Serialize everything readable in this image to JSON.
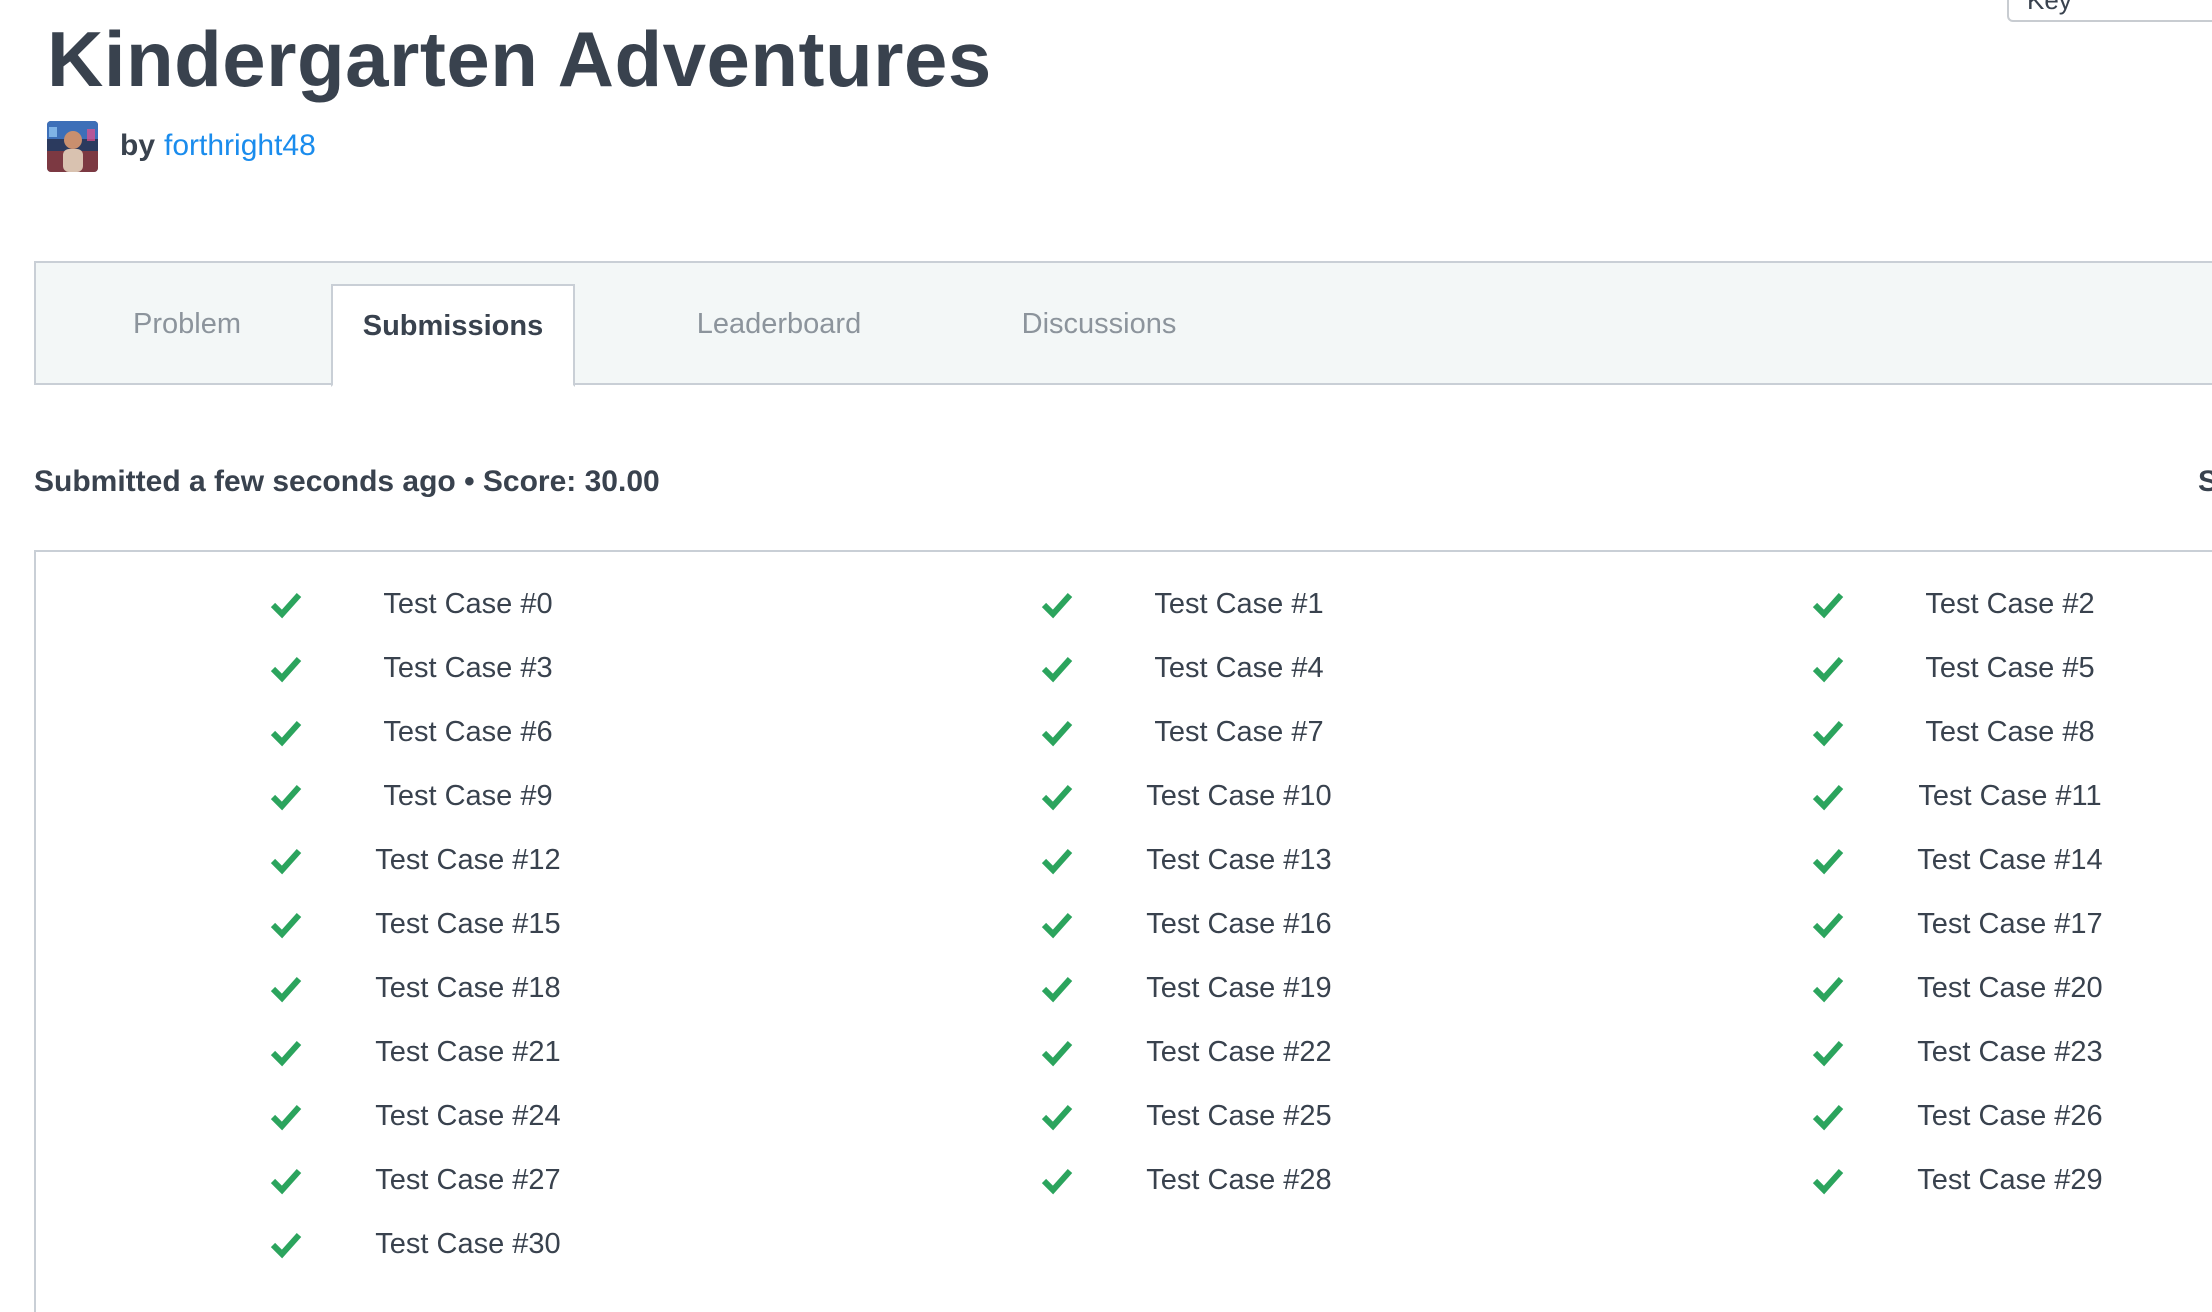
{
  "key_field": {
    "label": "Key"
  },
  "challenge": {
    "title": "Kindergarten Adventures",
    "by_label": "by",
    "author": "forthright48"
  },
  "tabs": [
    {
      "label": "Problem",
      "active": false
    },
    {
      "label": "Submissions",
      "active": true
    },
    {
      "label": "Leaderboard",
      "active": false
    },
    {
      "label": "Discussions",
      "active": false
    }
  ],
  "submission": {
    "status_text": "Submitted a few seconds ago • Score: 30.00",
    "right_cut_text": "S"
  },
  "colors": {
    "pass_green": "#2ba45d",
    "link_blue": "#1a8ced",
    "text_dark": "#39424e",
    "tab_inactive": "#8c949c"
  },
  "test_cases": [
    {
      "label": "Test Case #0",
      "status": "passed",
      "icon": "check-icon"
    },
    {
      "label": "Test Case #1",
      "status": "passed",
      "icon": "check-icon"
    },
    {
      "label": "Test Case #2",
      "status": "passed",
      "icon": "check-icon"
    },
    {
      "label": "Test Case #3",
      "status": "passed",
      "icon": "check-icon"
    },
    {
      "label": "Test Case #4",
      "status": "passed",
      "icon": "check-icon"
    },
    {
      "label": "Test Case #5",
      "status": "passed",
      "icon": "check-icon"
    },
    {
      "label": "Test Case #6",
      "status": "passed",
      "icon": "check-icon"
    },
    {
      "label": "Test Case #7",
      "status": "passed",
      "icon": "check-icon"
    },
    {
      "label": "Test Case #8",
      "status": "passed",
      "icon": "check-icon"
    },
    {
      "label": "Test Case #9",
      "status": "passed",
      "icon": "check-icon"
    },
    {
      "label": "Test Case #10",
      "status": "passed",
      "icon": "check-icon"
    },
    {
      "label": "Test Case #11",
      "status": "passed",
      "icon": "check-icon"
    },
    {
      "label": "Test Case #12",
      "status": "passed",
      "icon": "check-icon"
    },
    {
      "label": "Test Case #13",
      "status": "passed",
      "icon": "check-icon"
    },
    {
      "label": "Test Case #14",
      "status": "passed",
      "icon": "check-icon"
    },
    {
      "label": "Test Case #15",
      "status": "passed",
      "icon": "check-icon"
    },
    {
      "label": "Test Case #16",
      "status": "passed",
      "icon": "check-icon"
    },
    {
      "label": "Test Case #17",
      "status": "passed",
      "icon": "check-icon"
    },
    {
      "label": "Test Case #18",
      "status": "passed",
      "icon": "check-icon"
    },
    {
      "label": "Test Case #19",
      "status": "passed",
      "icon": "check-icon"
    },
    {
      "label": "Test Case #20",
      "status": "passed",
      "icon": "check-icon"
    },
    {
      "label": "Test Case #21",
      "status": "passed",
      "icon": "check-icon"
    },
    {
      "label": "Test Case #22",
      "status": "passed",
      "icon": "check-icon"
    },
    {
      "label": "Test Case #23",
      "status": "passed",
      "icon": "check-icon"
    },
    {
      "label": "Test Case #24",
      "status": "passed",
      "icon": "check-icon"
    },
    {
      "label": "Test Case #25",
      "status": "passed",
      "icon": "check-icon"
    },
    {
      "label": "Test Case #26",
      "status": "passed",
      "icon": "check-icon"
    },
    {
      "label": "Test Case #27",
      "status": "passed",
      "icon": "check-icon"
    },
    {
      "label": "Test Case #28",
      "status": "passed",
      "icon": "check-icon"
    },
    {
      "label": "Test Case #29",
      "status": "passed",
      "icon": "check-icon"
    },
    {
      "label": "Test Case #30",
      "status": "passed",
      "icon": "check-icon"
    }
  ]
}
